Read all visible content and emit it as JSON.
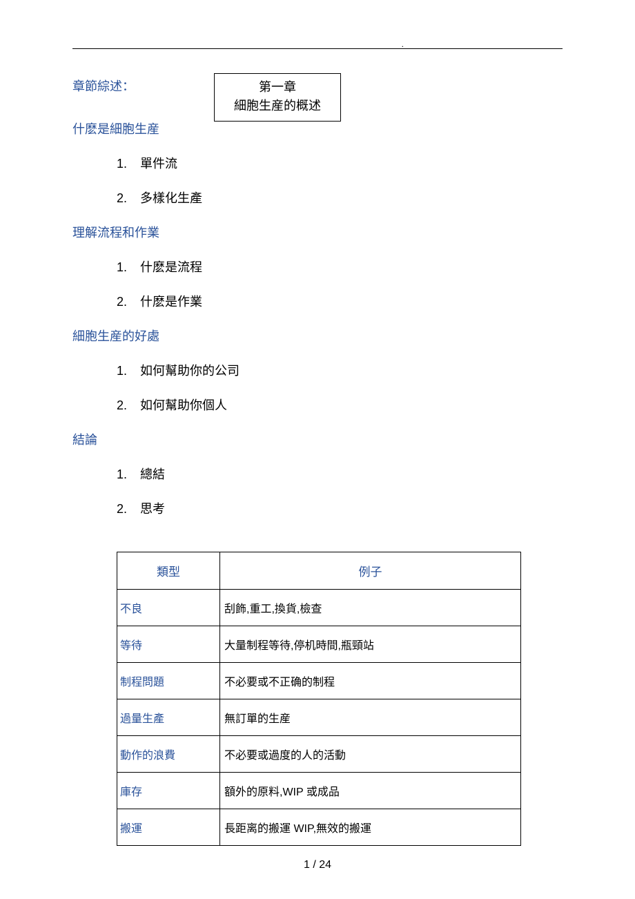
{
  "chapter": {
    "line1": "第一章",
    "line2": "細胞生産的概述"
  },
  "overview_label": "章節綜述：",
  "sections": [
    {
      "title": "什麽是細胞生産",
      "items": [
        "單件流",
        "多樣化生產"
      ]
    },
    {
      "title": "理解流程和作業",
      "items": [
        "什麽是流程",
        "什麽是作業"
      ]
    },
    {
      "title": "細胞生産的好處",
      "items": [
        "如何幫助你的公司",
        "如何幫助你個人"
      ]
    },
    {
      "title": "結論",
      "items": [
        "總結",
        "思考"
      ]
    }
  ],
  "table": {
    "headers": {
      "type": "類型",
      "example": "例子"
    },
    "rows": [
      {
        "type": "不良",
        "example": "刮飾,重工,換貨,檢查"
      },
      {
        "type": "等待",
        "example": "大量制程等待,停机時間,瓶頸站"
      },
      {
        "type": "制程問題",
        "example": "不必要或不正确的制程"
      },
      {
        "type": "過量生產",
        "example": "無訂單的生産"
      },
      {
        "type": "動作的浪費",
        "example": "不必要或過度的人的活動"
      },
      {
        "type": "庫存",
        "example": "額外的原料,WIP 或成品"
      },
      {
        "type": "搬運",
        "example": "長距离的搬運 WIP,無效的搬運"
      }
    ]
  },
  "page_number": "1 / 24"
}
